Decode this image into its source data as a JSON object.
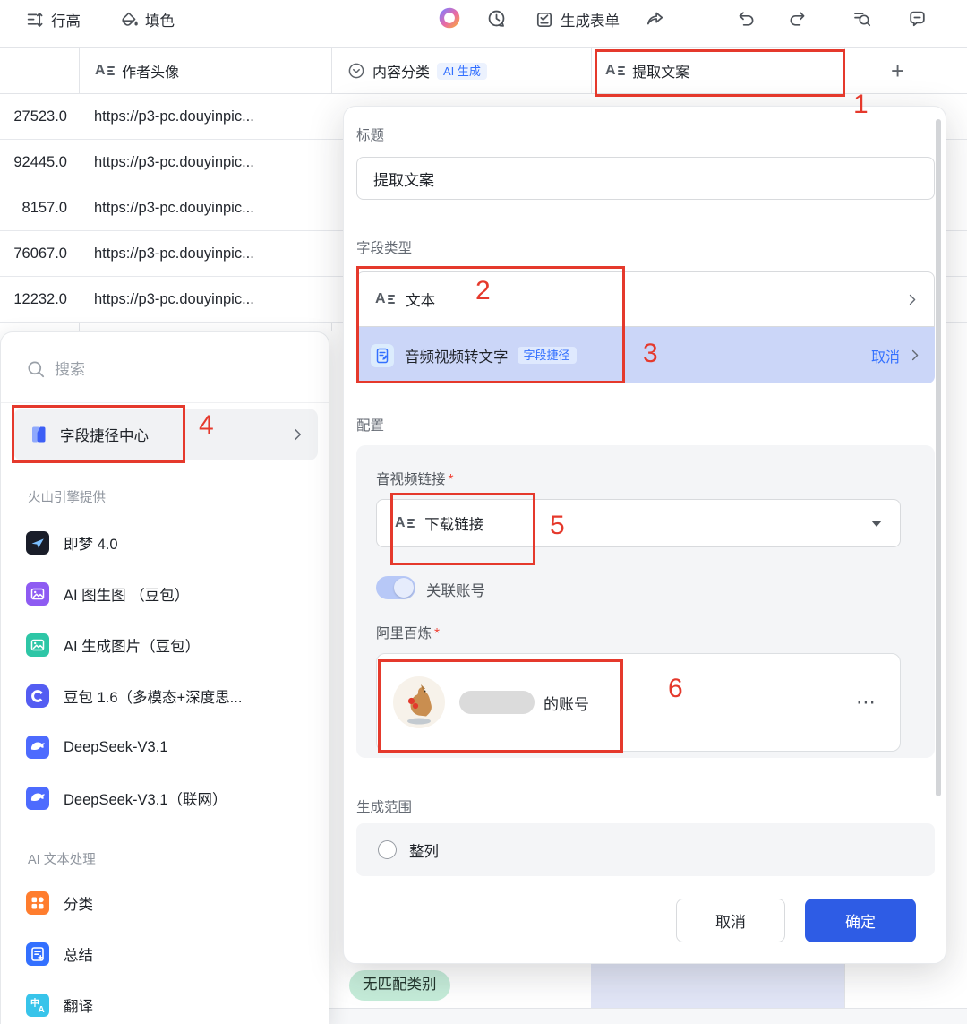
{
  "toolbar": {
    "row_height_label": "行高",
    "fill_label": "填色",
    "generate_form_label": "生成表单"
  },
  "table": {
    "col_author_avatar": "作者头像",
    "col_content_category": "内容分类",
    "ai_badge": "AI 生成",
    "col_extract_copy": "提取文案",
    "add_label": "+",
    "rows": [
      {
        "value": "27523.0",
        "url": "https://p3-pc.douyinpic..."
      },
      {
        "value": "92445.0",
        "url": "https://p3-pc.douyinpic..."
      },
      {
        "value": "8157.0",
        "url": "https://p3-pc.douyinpic..."
      },
      {
        "value": "76067.0",
        "url": "https://p3-pc.douyinpic..."
      },
      {
        "value": "12232.0",
        "url": "https://p3-pc.douyinpic..."
      }
    ],
    "no_match_label": "无匹配类别"
  },
  "shortcut_panel": {
    "search_placeholder": "搜索",
    "shortcut_center_label": "字段捷径中心",
    "section1_title": "火山引擎提供",
    "section2_title": "AI 文本处理",
    "items": [
      {
        "label": "即梦 4.0"
      },
      {
        "label": "AI 图生图 （豆包）"
      },
      {
        "label": "AI 生成图片（豆包）"
      },
      {
        "label": "豆包 1.6（多模态+深度思..."
      },
      {
        "label": "DeepSeek-V3.1"
      },
      {
        "label": "DeepSeek-V3.1（联网）"
      },
      {
        "label": "分类"
      },
      {
        "label": "总结"
      },
      {
        "label": "翻译"
      }
    ],
    "translate_glyph": {
      "cn": "中",
      "en": "A"
    }
  },
  "dialog": {
    "title_label": "标题",
    "title_value": "提取文案",
    "field_type_label": "字段类型",
    "type_text_label": "文本",
    "shortcut_item_label": "音频视频转文字",
    "shortcut_badge": "字段捷径",
    "cancel_link": "取消",
    "config_label": "配置",
    "av_link_label": "音视频链接",
    "required_mark": "*",
    "av_link_value": "下载链接",
    "link_account_label": "关联账号",
    "bailian_label": "阿里百炼",
    "account_suffix": "的账号",
    "more_label": "⋯",
    "range_label": "生成范围",
    "range_option_label": "整列",
    "cancel_button": "取消",
    "confirm_button": "确定"
  },
  "annotations": {
    "n1": "1",
    "n2": "2",
    "n3": "3",
    "n4": "4",
    "n5": "5",
    "n6": "6"
  },
  "icons": {
    "a_glyph": "A"
  },
  "colors": {
    "accent_blue": "#3370ff",
    "confirm_blue": "#2e5ce5",
    "annotation_red": "#e5392c",
    "selected_row": "#cbd6f8",
    "mint_badge": "#c5ecd9",
    "lavender_cell": "#e1e5f6"
  }
}
